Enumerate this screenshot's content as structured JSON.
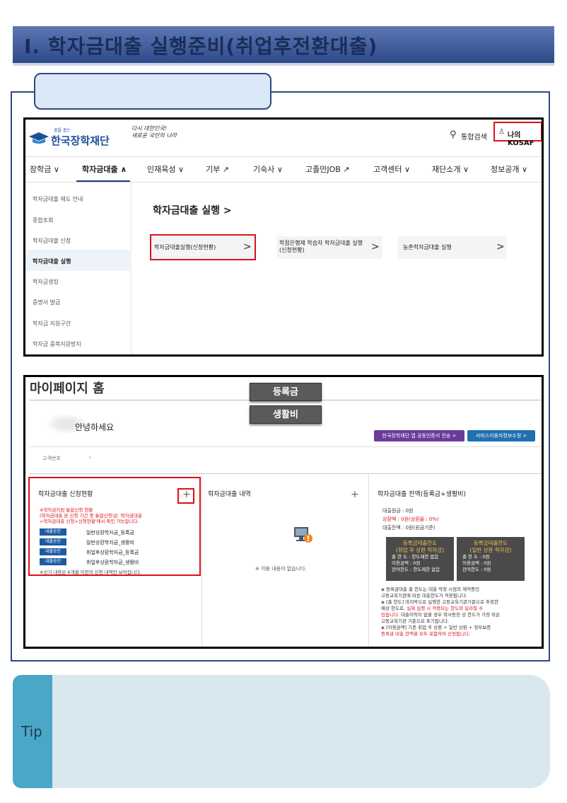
{
  "heading": {
    "title": "Ⅰ. 학자금대출 실행준비(취업후전환대출)"
  },
  "site": {
    "logo_tagline": "꿈을 돕는",
    "logo_name": "한국장학재단",
    "slogan_line1": "다시 대한민국!",
    "slogan_line2": "새로운 국민의 나라",
    "search_label": "통합검색",
    "login_label": "나의 KOSAF"
  },
  "nav": {
    "items": [
      "장학금 ∨",
      "학자금대출 ∧",
      "인재육성 ∨",
      "기부 ↗",
      "기숙사 ∨",
      "고졸만JOB ↗",
      "고객센터 ∨",
      "재단소개 ∨",
      "정보공개 ∨"
    ]
  },
  "sidebar": {
    "items": [
      "학자금대출 제도 안내",
      "종합조회",
      "학자금대출 신청",
      "학자금대출 실행",
      "학자금생킹",
      "증명서 발급",
      "학자금 지원구간",
      "학자금 중복지원방지"
    ]
  },
  "content": {
    "title": "학자금대출 실행 >",
    "cards": [
      {
        "label": "학자금대출실행(신청현황)"
      },
      {
        "label_line1": "학점은행제 학습자 학자금대출 실행",
        "label_line2": "(신청현황)"
      },
      {
        "label": "농촌학자금대출 실행"
      }
    ],
    "arrow": ">"
  },
  "mypage": {
    "title": "마이페이지 홈",
    "btn_tuition": "등록금",
    "btn_living": "생활비",
    "greeting": "안녕하세요",
    "btn_cert": "한국장학재단 앱 공동인증서 전송 >",
    "btn_service": "서비스이용자정보수정 >",
    "account_label": "고객번호",
    "account_arrow": "›",
    "panel1": {
      "title": "학자금대출 신청현황",
      "plus": "+",
      "note_line1": "※학자금지원 통합신청 현황",
      "note_line2": "(학자금대출 본 신청 기간 중 통합신청)은 '학자금대출",
      "note_line3": ">학자금대출 신청>신청현황'에서 확인 가능합니다.",
      "rows": [
        {
          "badge": "대출승인",
          "text": "일반상환학자금_등록금"
        },
        {
          "badge": "대출승인",
          "text": "일반상환학자금_생활비"
        },
        {
          "badge": "대출승인",
          "text": "취업후상환학자금_등록금"
        },
        {
          "badge": "대출승인",
          "text": "취업후상환학자금_생활비"
        }
      ],
      "footer": "※상기 내용은 6개월 이전의 신청 내역만 보여집니다."
    },
    "panel2": {
      "title": "학자금대출 내역",
      "plus": "+",
      "empty": "※ 이용 내용이 없습니다."
    },
    "panel3": {
      "title": "학자금대출 잔액(등록금+생활비)",
      "balance_total": "대출원금 : 0원",
      "balance_repaid": "상환액 : 0원(상환율 : 0%)",
      "balance_left": "대출잔액 : 0원(원금기준)",
      "box1_title_1": "등록금대출한도",
      "box1_title_2": "(취업 후 상환 학자금)",
      "box1_r1": "총 한 도 : 한도제한 없음",
      "box1_r2": "이용금액 : 0원",
      "box1_r3": "잔여한도 : 한도제한 없음",
      "box2_title_1": "등록금대출한도",
      "box2_title_2": "(일반 상환 학자금)",
      "box2_r1": "총 한 도 : 0원",
      "box2_r2": "이용금액 : 0원",
      "box2_r3": "잔여한도 : 0원",
      "note1": "◈ 등록금대출 총 한도는 대출 약정 시점의 재적중인",
      "note1b": "고등교육기관에 따른 대출한도가 적용됩니다.",
      "note2": "◈ [총 한도] 마지막으로 실행한 고등교육기관기준으로 추정한",
      "note2b": "예상 한도로,",
      "note2c": "실제 실행 시 적용되는 한도와 달라질 수",
      "note2d": "있습니다.",
      "note2e": "대출이력이 없을 경우 학사등장 상 한도가 가장 작은",
      "note2f": "고등교육기관 기준으로 표기됩니다.",
      "note3": "◈ [이용금액] 기존 취업 후 상환 + 일반 상환 + 정부보증",
      "note3b": "등록금 대출 잔액을 모두 포함하여 산정됩니다."
    }
  },
  "tip": {
    "label": "Tip"
  },
  "colors": {
    "primary": "#2b4a7e",
    "highlight": "#d9121b",
    "tip": "#4ba7c7"
  }
}
